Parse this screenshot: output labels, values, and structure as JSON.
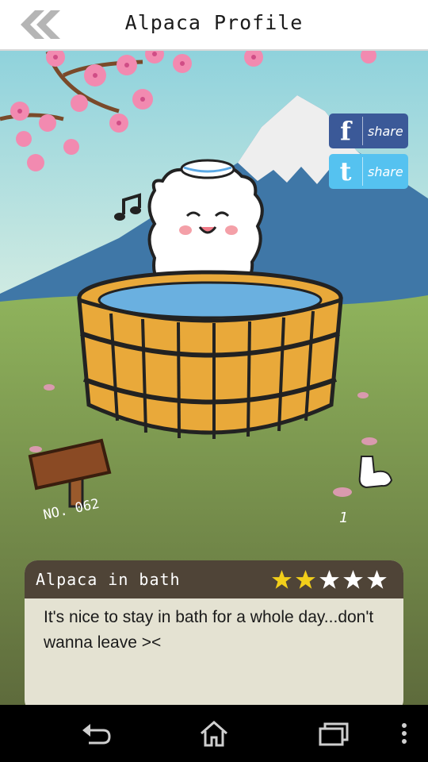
{
  "header": {
    "title": "Alpaca Profile"
  },
  "share": {
    "facebook_label": "share",
    "twitter_label": "share"
  },
  "sign": {
    "number": "NO. 062"
  },
  "owned": {
    "count": "1"
  },
  "card": {
    "name": "Alpaca in bath",
    "rating": 2,
    "rating_max": 5,
    "description": "It's nice to stay in bath for a whole day...don't wanna leave ><"
  },
  "colors": {
    "star_on": "#f2cf1a",
    "star_off": "#ffffff",
    "card_header": "#4f4437",
    "card_body": "#e4e2d2"
  }
}
